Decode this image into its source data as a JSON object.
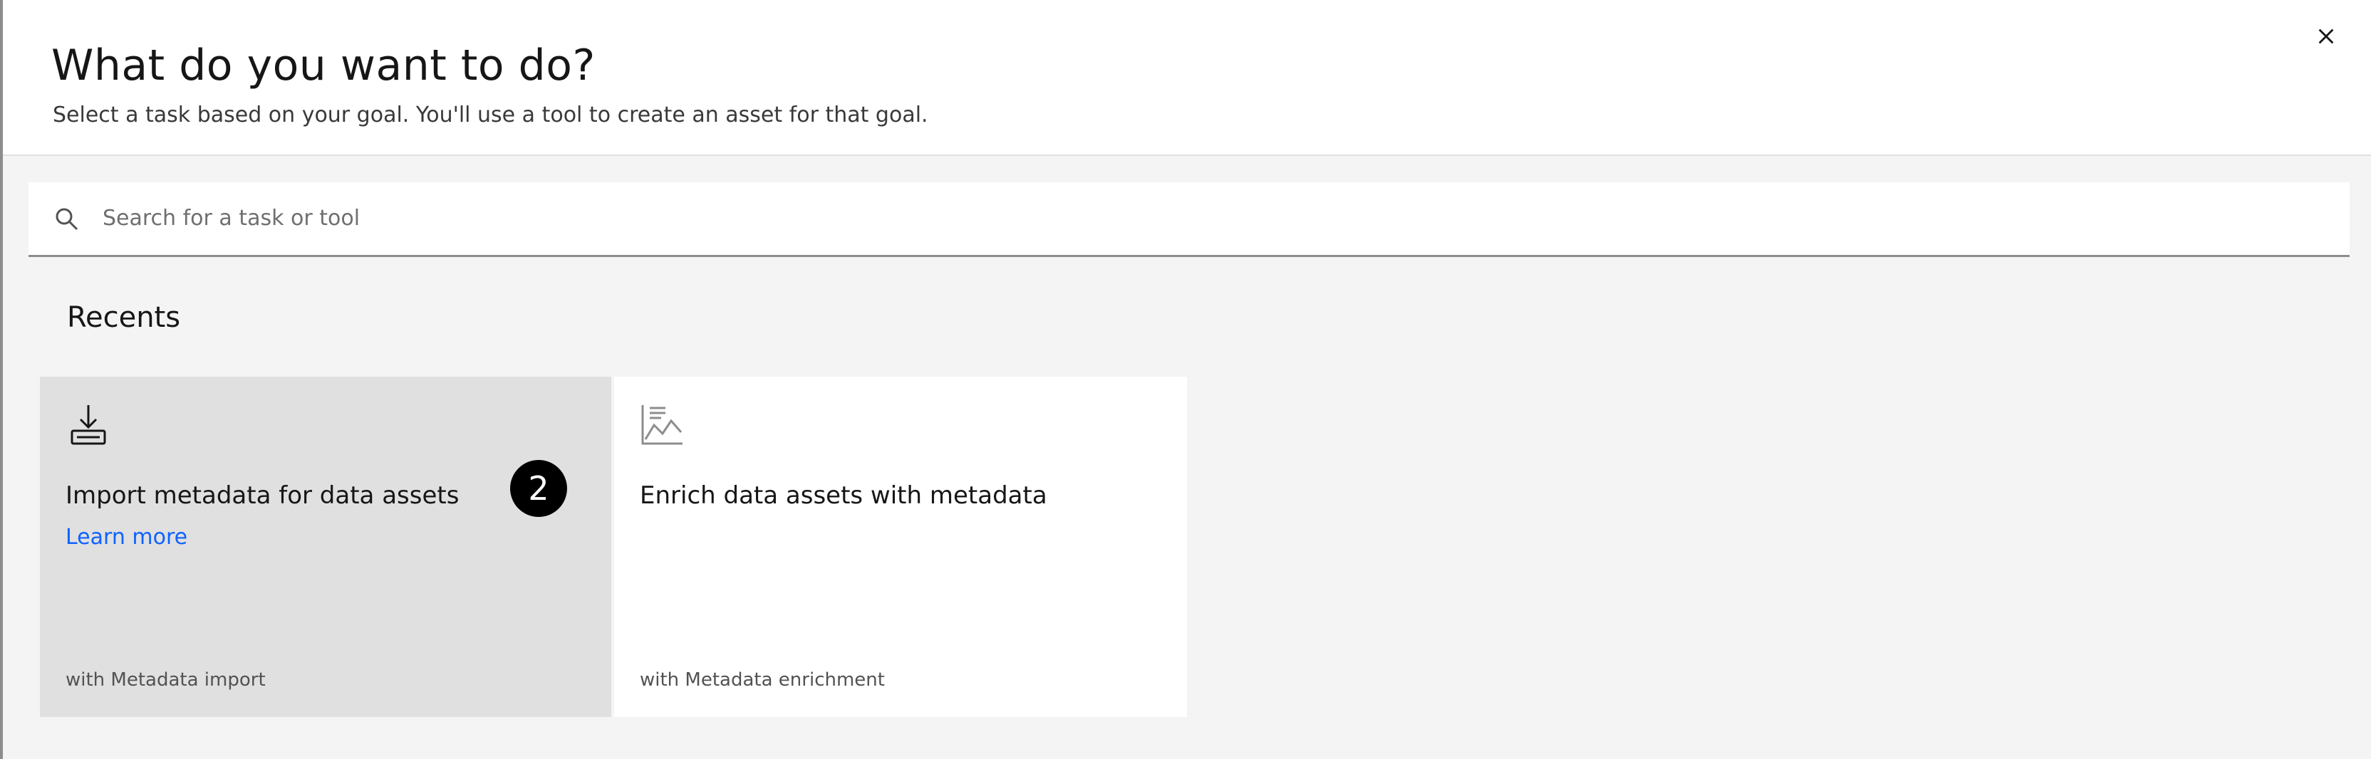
{
  "header": {
    "title": "What do you want to do?",
    "subtitle": "Select a task based on your goal. You'll use a tool to create an asset for that goal."
  },
  "search": {
    "placeholder": "Search for a task or tool",
    "value": ""
  },
  "recents": {
    "section_title": "Recents",
    "cards": [
      {
        "icon": "download-icon",
        "title": "Import metadata for data assets",
        "link": "Learn more",
        "tool": "with Metadata import",
        "badge": "2"
      },
      {
        "icon": "chart-line-icon",
        "title": "Enrich data assets with metadata",
        "tool": "with Metadata enrichment"
      }
    ]
  },
  "colors": {
    "page_bg": "#f4f4f4",
    "card_selected_bg": "#e0e0e0",
    "card_bg": "#ffffff",
    "link": "#0f62fe",
    "text": "#161616",
    "muted": "#525252"
  }
}
